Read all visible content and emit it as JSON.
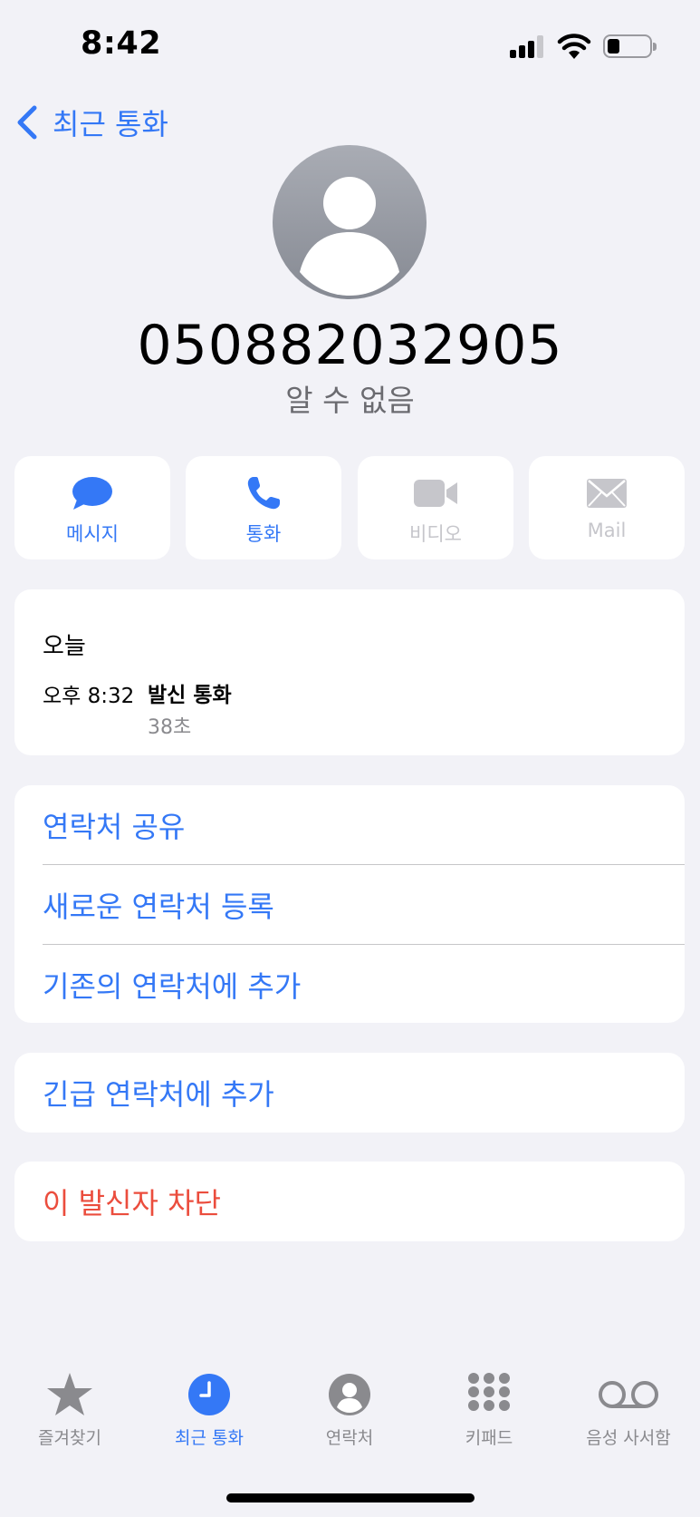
{
  "status_bar": {
    "time": "8:42"
  },
  "nav": {
    "back_label": "최근 통화"
  },
  "contact": {
    "number": "050882032905",
    "subtitle": "알 수 없음"
  },
  "actions": [
    {
      "label": "메시지",
      "icon": "message-icon",
      "enabled": true
    },
    {
      "label": "통화",
      "icon": "phone-icon",
      "enabled": true
    },
    {
      "label": "비디오",
      "icon": "video-icon",
      "enabled": false
    },
    {
      "label": "Mail",
      "icon": "mail-icon",
      "enabled": false
    }
  ],
  "history": {
    "day": "오늘",
    "entries": [
      {
        "time": "오후 8:32",
        "type": "발신 통화",
        "duration": "38초"
      }
    ]
  },
  "contact_options": [
    "연락처 공유",
    "새로운 연락처 등록",
    "기존의 연락처에 추가"
  ],
  "emergency_label": "긴급 연락처에 추가",
  "block_label": "이 발신자 차단",
  "tabs": [
    {
      "label": "즐겨찾기",
      "icon": "star-icon",
      "active": false
    },
    {
      "label": "최근 통화",
      "icon": "clock-icon",
      "active": true
    },
    {
      "label": "연락처",
      "icon": "person-circle-icon",
      "active": false
    },
    {
      "label": "키패드",
      "icon": "keypad-icon",
      "active": false
    },
    {
      "label": "음성 사서함",
      "icon": "voicemail-icon",
      "active": false
    }
  ],
  "colors": {
    "accent": "#3478f6",
    "destructive": "#eb4d3d",
    "background": "#f2f2f7",
    "disabled": "#c6c6cb"
  }
}
